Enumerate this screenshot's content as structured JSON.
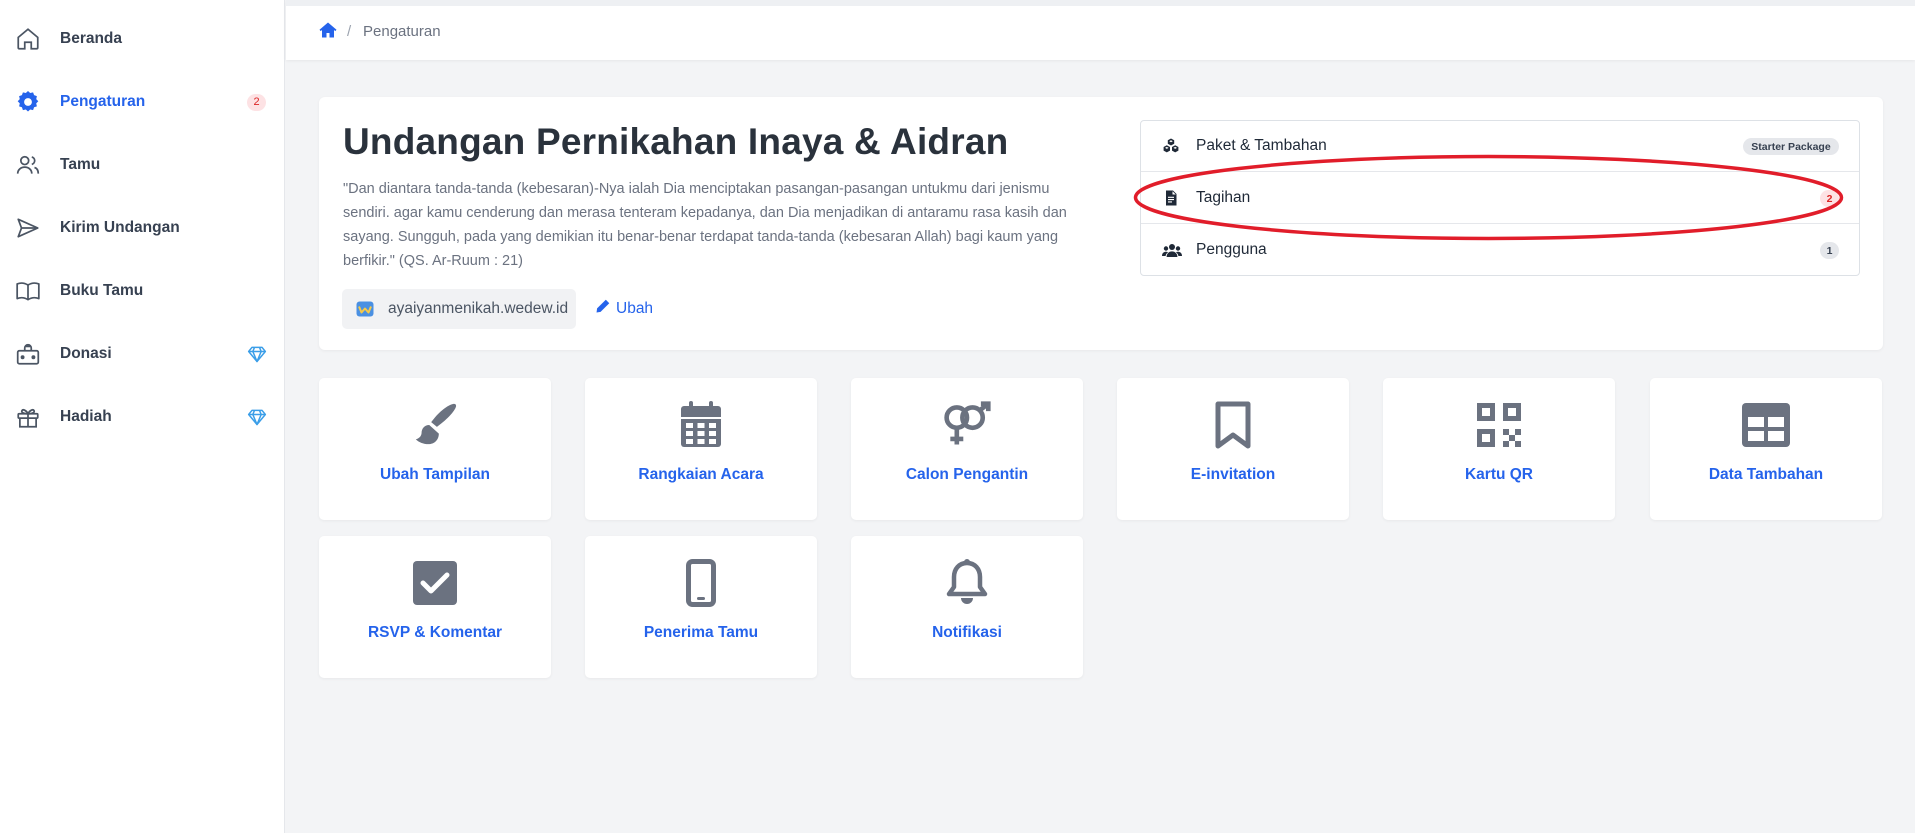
{
  "sidebar": {
    "items": [
      {
        "label": "Beranda",
        "icon": "home-icon"
      },
      {
        "label": "Pengaturan",
        "icon": "gear-icon",
        "badge": "2",
        "active": true
      },
      {
        "label": "Tamu",
        "icon": "users-icon"
      },
      {
        "label": "Kirim Undangan",
        "icon": "send-icon"
      },
      {
        "label": "Buku Tamu",
        "icon": "book-icon"
      },
      {
        "label": "Donasi",
        "icon": "donation-box-icon",
        "premium": true
      },
      {
        "label": "Hadiah",
        "icon": "gift-icon",
        "premium": true
      }
    ]
  },
  "breadcrumb": {
    "separator": "/",
    "current": "Pengaturan"
  },
  "event": {
    "title": "Undangan Pernikahan Inaya & Aidran",
    "quote": "\"Dan diantara tanda-tanda (kebesaran)-Nya ialah Dia menciptakan pasangan-pasangan untukmu dari jenismu sendiri. agar kamu cenderung dan merasa tenteram kepadanya, dan Dia menjadikan di antaramu rasa kasih dan sayang. Sungguh, pada yang demikian itu benar-benar terdapat tanda-tanda (kebesaran Allah) bagi kaum yang berfikir.\" (QS. Ar-Ruum : 21)",
    "domain": "ayaiyanmenikah.wedew.id",
    "edit_label": "Ubah"
  },
  "side_list": [
    {
      "label": "Paket & Tambahan",
      "icon": "cubes-icon",
      "badge": "Starter Package",
      "badge_style": "gray"
    },
    {
      "label": "Tagihan",
      "icon": "invoice-icon",
      "badge": "2",
      "badge_style": "red",
      "highlighted": true
    },
    {
      "label": "Pengguna",
      "icon": "users-group-icon",
      "badge": "1",
      "badge_style": "gray"
    }
  ],
  "tiles": [
    {
      "label": "Ubah Tampilan",
      "icon": "paint-brush-icon"
    },
    {
      "label": "Rangkaian Acara",
      "icon": "calendar-icon"
    },
    {
      "label": "Calon Pengantin",
      "icon": "venus-mars-icon"
    },
    {
      "label": "E-invitation",
      "icon": "bookmark-icon"
    },
    {
      "label": "Kartu QR",
      "icon": "qr-code-icon"
    },
    {
      "label": "Data Tambahan",
      "icon": "table-icon"
    },
    {
      "label": "RSVP & Komentar",
      "icon": "check-square-icon"
    },
    {
      "label": "Penerima Tamu",
      "icon": "mobile-phone-icon"
    },
    {
      "label": "Notifikasi",
      "icon": "bell-icon"
    }
  ],
  "colors": {
    "accent": "#2563eb",
    "highlight_ring": "#e11d2a",
    "icon_gray": "#6b7280",
    "premium_gem": "#3b9ee8"
  }
}
